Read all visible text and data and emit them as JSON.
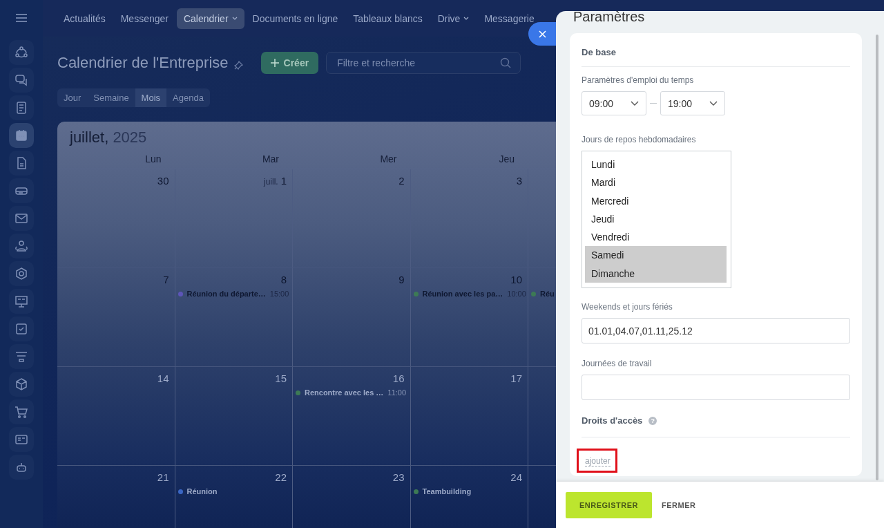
{
  "sidebar": {
    "items": [
      {
        "selected": false
      },
      {
        "selected": false
      },
      {
        "selected": false
      },
      {
        "selected": true
      },
      {
        "selected": false
      },
      {
        "selected": false
      },
      {
        "selected": false
      },
      {
        "selected": false
      },
      {
        "selected": false
      },
      {
        "selected": false
      },
      {
        "selected": false
      },
      {
        "selected": false
      },
      {
        "selected": false
      },
      {
        "selected": false
      },
      {
        "selected": false
      },
      {
        "selected": false
      }
    ]
  },
  "top_nav": [
    {
      "label": "Actualités",
      "selected": false,
      "dropdown": false
    },
    {
      "label": "Messenger",
      "selected": false,
      "dropdown": false
    },
    {
      "label": "Calendrier",
      "selected": true,
      "dropdown": true
    },
    {
      "label": "Documents en ligne",
      "selected": false,
      "dropdown": false
    },
    {
      "label": "Tableaux blancs",
      "selected": false,
      "dropdown": false
    },
    {
      "label": "Drive",
      "selected": false,
      "dropdown": true
    },
    {
      "label": "Messagerie",
      "selected": false,
      "dropdown": false
    }
  ],
  "page_title": "Calendrier de l'Entreprise",
  "create_button": "Créer",
  "search": {
    "placeholder": "Filtre et recherche"
  },
  "view_tabs": [
    {
      "label": "Jour",
      "selected": false
    },
    {
      "label": "Semaine",
      "selected": false
    },
    {
      "label": "Mois",
      "selected": true
    },
    {
      "label": "Agenda",
      "selected": false
    }
  ],
  "calendar": {
    "month": "juillet,",
    "year": "2025",
    "weekdays": [
      "Lun",
      "Mar",
      "Mer",
      "Jeu"
    ],
    "weeks": [
      {
        "days": [
          {
            "date": "30"
          },
          {
            "prefix": "juill.",
            "date": "1"
          },
          {
            "date": "2"
          },
          {
            "date": "3"
          }
        ]
      },
      {
        "days": [
          {
            "date": "7"
          },
          {
            "date": "8",
            "events": [
              {
                "title": "Réunion du départe…",
                "time": "15:00",
                "color": "#5d55b8"
              }
            ]
          },
          {
            "date": "9"
          },
          {
            "date": "10",
            "events": [
              {
                "title": "Réunion avec les pa…",
                "time": "10:00",
                "color": "#3d7a55"
              }
            ]
          },
          {
            "events": [
              {
                "title": "Réu",
                "color": "#3d7a55"
              }
            ]
          }
        ]
      },
      {
        "days": [
          {
            "date": "14"
          },
          {
            "date": "15"
          },
          {
            "date": "16",
            "events": [
              {
                "title": "Rencontre avec les …",
                "time": "11:00",
                "color": "#3d7a55"
              }
            ]
          },
          {
            "date": "17"
          }
        ]
      },
      {
        "days": [
          {
            "date": "21"
          },
          {
            "date": "22",
            "events": [
              {
                "title": "Réunion",
                "color": "#3a66c4"
              }
            ]
          },
          {
            "date": "23"
          },
          {
            "date": "24",
            "events": [
              {
                "title": "Teambuilding",
                "color": "#3d7a55"
              }
            ]
          }
        ]
      }
    ]
  },
  "panel": {
    "title": "Paramètres",
    "section_basic": "De base",
    "schedule_label": "Paramètres d'emploi du temps",
    "time_from": "09:00",
    "time_to": "19:00",
    "rest_days_label": "Jours de repos hebdomadaires",
    "rest_days": [
      {
        "label": "Lundi",
        "selected": false
      },
      {
        "label": "Mardi",
        "selected": false
      },
      {
        "label": "Mercredi",
        "selected": false
      },
      {
        "label": "Jeudi",
        "selected": false
      },
      {
        "label": "Vendredi",
        "selected": false
      },
      {
        "label": "Samedi",
        "selected": true
      },
      {
        "label": "Dimanche",
        "selected": true
      }
    ],
    "holidays_label": "Weekends et jours fériés",
    "holidays_value": "01.01,04.07,01.11,25.12",
    "workdays_label": "Journées de travail",
    "access_label": "Droits d'accès",
    "help": "?",
    "add_link": {
      "label": "ajouter",
      "highlighted": true
    },
    "save_button": "ENREGISTRER",
    "close_button": "FERMER"
  }
}
